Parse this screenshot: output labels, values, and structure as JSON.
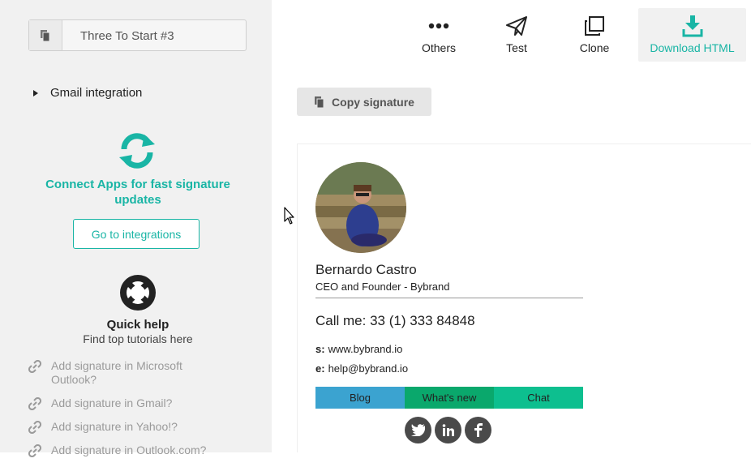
{
  "sidebar": {
    "signature_name": "Three To Start #3",
    "gmail_integration": "Gmail integration",
    "connect_text": "Connect Apps for fast signature updates",
    "goto_button": "Go to integrations",
    "quick_help_title": "Quick help",
    "quick_help_subtitle": "Find top tutorials here",
    "tutorials": [
      {
        "label": "Add signature in Microsoft Outlook?"
      },
      {
        "label": "Add signature in Gmail?"
      },
      {
        "label": "Add signature in Yahoo!?"
      },
      {
        "label": "Add signature in Outlook.com?"
      }
    ]
  },
  "toolbar": {
    "others": "Others",
    "test": "Test",
    "clone": "Clone",
    "download": "Download HTML"
  },
  "main": {
    "copy_signature": "Copy signature"
  },
  "signature": {
    "name": "Bernardo Castro",
    "title": "CEO and Founder - Bybrand",
    "call": "Call me: 33 (1) 333 84848",
    "site_label": "s:",
    "site": "www.bybrand.io",
    "email_label": "e:",
    "email": "help@bybrand.io",
    "tabs": {
      "blog": "Blog",
      "news": "What's new",
      "chat": "Chat"
    },
    "socials": [
      "twitter-icon",
      "linkedin-icon",
      "facebook-icon"
    ]
  },
  "colors": {
    "accent": "#19b5a5",
    "blog": "#3ba3d0",
    "news": "#0aa86c",
    "chat": "#0dbf8f"
  }
}
